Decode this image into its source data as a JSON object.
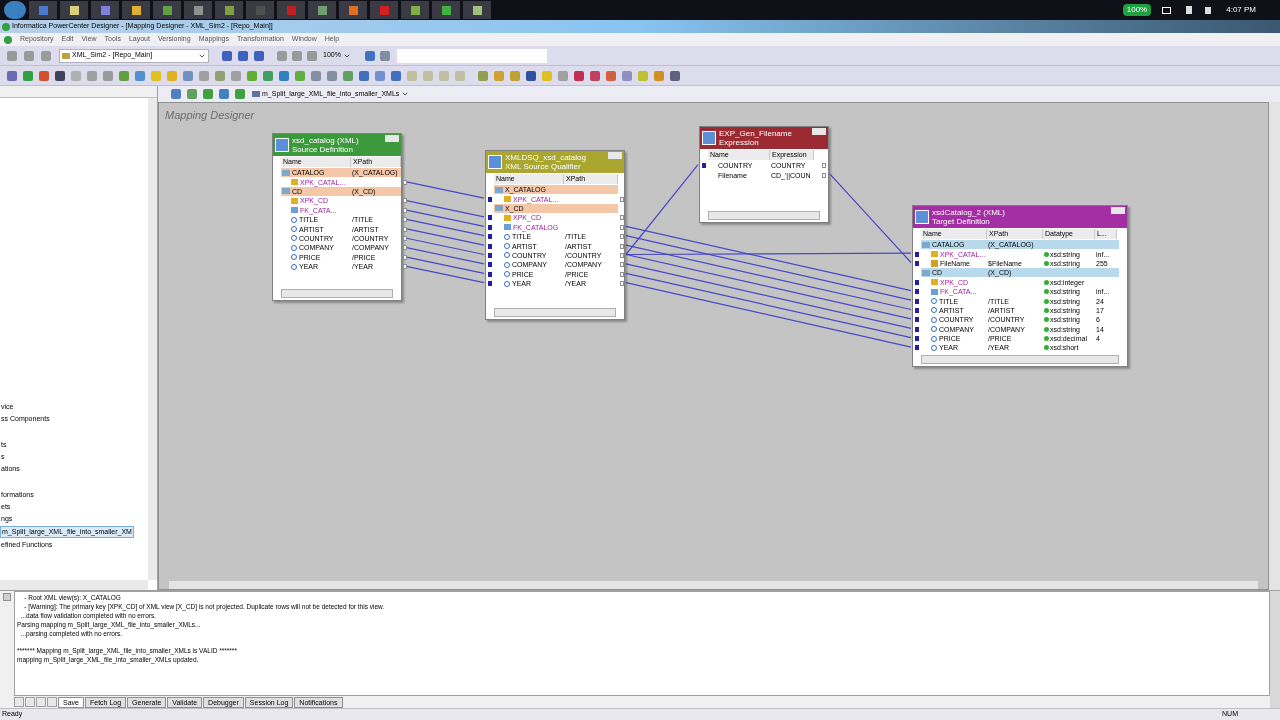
{
  "taskbar": {
    "battery": "100%",
    "clock": "4:07 PM"
  },
  "window": {
    "title": "Informatica PowerCenter Designer - [Mapping Designer - XML_Sim2 - [Repo_Main]]"
  },
  "menu": [
    "Repository",
    "Edit",
    "View",
    "Tools",
    "Layout",
    "Versioning",
    "Mappings",
    "Transformation",
    "Window",
    "Help"
  ],
  "toolbar": {
    "folder": "XML_Sim2 - [Repo_Main]",
    "zoom": "100%"
  },
  "navigator": {
    "items": [
      {
        "label": "vice",
        "selected": false
      },
      {
        "label": "ss Components",
        "selected": false
      },
      {
        "label": "ts",
        "selected": false
      },
      {
        "label": "s",
        "selected": false
      },
      {
        "label": "ations",
        "selected": false
      },
      {
        "label": "formations",
        "selected": false
      },
      {
        "label": "ets",
        "selected": false
      },
      {
        "label": "ngs",
        "selected": false
      },
      {
        "label": "m_Split_large_XML_file_into_smaller_XM",
        "selected": true
      },
      {
        "label": "efined Functions",
        "selected": false
      }
    ]
  },
  "workspace": {
    "mapping_tab": "m_Split_large_XML_file_into_smaller_XMLs",
    "canvas_label": "Mapping Designer",
    "nodes": [
      {
        "kind": "source",
        "title": "xsd_catalog (XML)",
        "subtitle": "Source Definition",
        "columns": [
          "Name",
          "XPath"
        ],
        "rows": [
          {
            "kind": "group",
            "name": "CATALOG",
            "xpath": "(X_CATALOG)",
            "port_in": false,
            "port_out": false
          },
          {
            "kind": "key",
            "name": "XPK_CATAL...",
            "port_in": false,
            "port_out": true
          },
          {
            "kind": "group",
            "name": "CD",
            "xpath": "(X_CD)",
            "port_in": false,
            "port_out": false
          },
          {
            "kind": "key",
            "name": "XPK_CD",
            "port_in": false,
            "port_out": true
          },
          {
            "kind": "fk",
            "name": "FK_CATA...",
            "port_in": false,
            "port_out": true
          },
          {
            "kind": "field",
            "name": "TITLE",
            "xpath": "/TITLE",
            "port_in": false,
            "port_out": true
          },
          {
            "kind": "field",
            "name": "ARTIST",
            "xpath": "/ARTIST",
            "port_in": false,
            "port_out": true
          },
          {
            "kind": "field",
            "name": "COUNTRY",
            "xpath": "/COUNTRY",
            "port_in": false,
            "port_out": true
          },
          {
            "kind": "field",
            "name": "COMPANY",
            "xpath": "/COMPANY",
            "port_in": false,
            "port_out": true
          },
          {
            "kind": "field",
            "name": "PRICE",
            "xpath": "/PRICE",
            "port_in": false,
            "port_out": true
          },
          {
            "kind": "field",
            "name": "YEAR",
            "xpath": "/YEAR",
            "port_in": false,
            "port_out": true
          }
        ]
      },
      {
        "kind": "source_qualifier",
        "title": "XMLDSQ_xsd_catalog",
        "subtitle": "XML Source Qualifier",
        "columns": [
          "Name",
          "XPath"
        ],
        "rows": [
          {
            "kind": "group",
            "name": "X_CATALOG",
            "port_in": false,
            "port_out": false
          },
          {
            "kind": "key",
            "name": "XPK_CATAL...",
            "port_in": true,
            "port_out": true
          },
          {
            "kind": "group",
            "name": "X_CD",
            "port_in": false,
            "port_out": false
          },
          {
            "kind": "key",
            "name": "XPK_CD",
            "port_in": true,
            "port_out": true
          },
          {
            "kind": "fk",
            "name": "FK_CATALOG",
            "port_in": true,
            "port_out": true
          },
          {
            "kind": "field",
            "name": "TITLE",
            "xpath": "/TITLE",
            "port_in": true,
            "port_out": true
          },
          {
            "kind": "field",
            "name": "ARTIST",
            "xpath": "/ARTIST",
            "port_in": true,
            "port_out": true
          },
          {
            "kind": "field",
            "name": "COUNTRY",
            "xpath": "/COUNTRY",
            "port_in": true,
            "port_out": true
          },
          {
            "kind": "field",
            "name": "COMPANY",
            "xpath": "/COMPANY",
            "port_in": true,
            "port_out": true
          },
          {
            "kind": "field",
            "name": "PRICE",
            "xpath": "/PRICE",
            "port_in": true,
            "port_out": true
          },
          {
            "kind": "field",
            "name": "YEAR",
            "xpath": "/YEAR",
            "port_in": true,
            "port_out": true
          }
        ]
      },
      {
        "kind": "expression",
        "title": "EXP_Gen_Filename",
        "subtitle": "Expression",
        "columns": [
          "Name",
          "Expression"
        ],
        "rows": [
          {
            "kind": "port",
            "name": "COUNTRY",
            "xpath": "COUNTRY",
            "port_in": true,
            "port_out": true
          },
          {
            "kind": "port",
            "name": "Filename",
            "xpath": "CD_'||COUN",
            "port_in": false,
            "port_out": true
          }
        ]
      },
      {
        "kind": "target",
        "title": "xsdCatalog_2 (XML)",
        "subtitle": "Target Definition",
        "columns": [
          "Name",
          "XPath",
          "Datatype",
          "L..."
        ],
        "rows": [
          {
            "kind": "group",
            "name": "CATALOG",
            "xpath": "(X_CATALOG)",
            "port_in": false,
            "port_out": false
          },
          {
            "kind": "key",
            "name": "XPK_CATAL...",
            "datatype": "xsd:string",
            "length": "inf...",
            "port_in": true,
            "port_out": false
          },
          {
            "kind": "file",
            "name": "FileName",
            "xpath": "$FileName",
            "datatype": "xsd:string",
            "length": "255",
            "port_in": true,
            "port_out": false
          },
          {
            "kind": "group",
            "name": "CD",
            "xpath": "(X_CD)",
            "port_in": false,
            "port_out": false
          },
          {
            "kind": "key",
            "name": "XPK_CD",
            "datatype": "xsd:integer",
            "port_in": true,
            "port_out": false
          },
          {
            "kind": "fk",
            "name": "FK_CATA...",
            "datatype": "xsd:string",
            "length": "inf...",
            "port_in": true,
            "port_out": false
          },
          {
            "kind": "field",
            "name": "TITLE",
            "xpath": "/TITLE",
            "datatype": "xsd:string",
            "length": "24",
            "port_in": true,
            "port_out": false
          },
          {
            "kind": "field",
            "name": "ARTIST",
            "xpath": "/ARTIST",
            "datatype": "xsd:string",
            "length": "17",
            "port_in": true,
            "port_out": false
          },
          {
            "kind": "field",
            "name": "COUNTRY",
            "xpath": "/COUNTRY",
            "datatype": "xsd:string",
            "length": "6",
            "port_in": true,
            "port_out": false
          },
          {
            "kind": "field",
            "name": "COMPANY",
            "xpath": "/COMPANY",
            "datatype": "xsd:string",
            "length": "14",
            "port_in": true,
            "port_out": false
          },
          {
            "kind": "field",
            "name": "PRICE",
            "xpath": "/PRICE",
            "datatype": "xsd:decimal",
            "length": "4",
            "port_in": true,
            "port_out": false
          },
          {
            "kind": "field",
            "name": "YEAR",
            "xpath": "/YEAR",
            "datatype": "xsd:short",
            "port_in": true,
            "port_out": false
          }
        ]
      }
    ]
  },
  "output": {
    "lines": [
      "    - Root XML view(s): X_CATALOG",
      "    - [Warning]: The primary key [XPK_CD] of XML view [X_CD] is not projected. Duplicate rows will not be detected for this view.",
      "  ...data flow validation completed with no errors.",
      "Parsing mapping m_Split_large_XML_file_into_smaller_XMLs...",
      "  ...parsing completed with no errors.",
      "******* Mapping m_Split_large_XML_file_into_smaller_XMLs is VALID *******",
      "mapping m_Split_large_XML_file_into_smaller_XMLs updated."
    ],
    "tabs": [
      {
        "label": "Save",
        "selected": true
      },
      {
        "label": "Fetch Log",
        "selected": false
      },
      {
        "label": "Generate",
        "selected": false
      },
      {
        "label": "Validate",
        "selected": false
      },
      {
        "label": "Debugger",
        "selected": false
      },
      {
        "label": "Session Log",
        "selected": false
      },
      {
        "label": "Notifications",
        "selected": false
      }
    ]
  },
  "status_bar": {
    "message": "Ready",
    "indicator": "NUM"
  }
}
